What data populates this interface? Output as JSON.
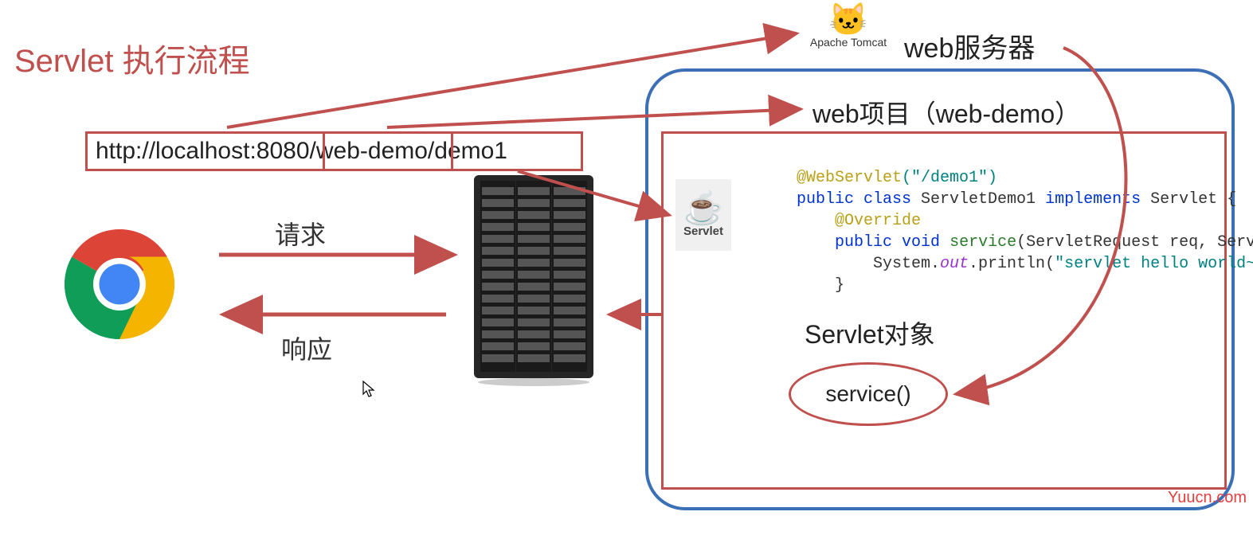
{
  "title": "Servlet 执行流程",
  "url": "http://localhost:8080/web-demo/demo1",
  "labels": {
    "request": "请求",
    "response": "响应",
    "webserver": "web服务器",
    "webproject": "web项目（web-demo）",
    "tomcat": "Apache Tomcat",
    "servlet_icon": "Servlet",
    "servlet_object": "Servlet对象",
    "service_method": "service()"
  },
  "code": {
    "line1_anno": "@WebServlet",
    "line1_str": "(\"/demo1\")",
    "line2_a": "public class",
    "line2_b": " ServletDemo1 ",
    "line2_c": "implements",
    "line2_d": " Servlet {",
    "line3_anno": "@Override",
    "line4_a": "public void",
    "line4_b": " ",
    "line4_fn": "service",
    "line4_c": "(ServletRequest req, ServletRe",
    "line5_a": "        System.",
    "line5_field": "out",
    "line5_b": ".println(",
    "line5_str": "\"servlet hello world~\"",
    "line5_c": ");",
    "line6": "    }"
  },
  "watermark": "Yuucn.com"
}
